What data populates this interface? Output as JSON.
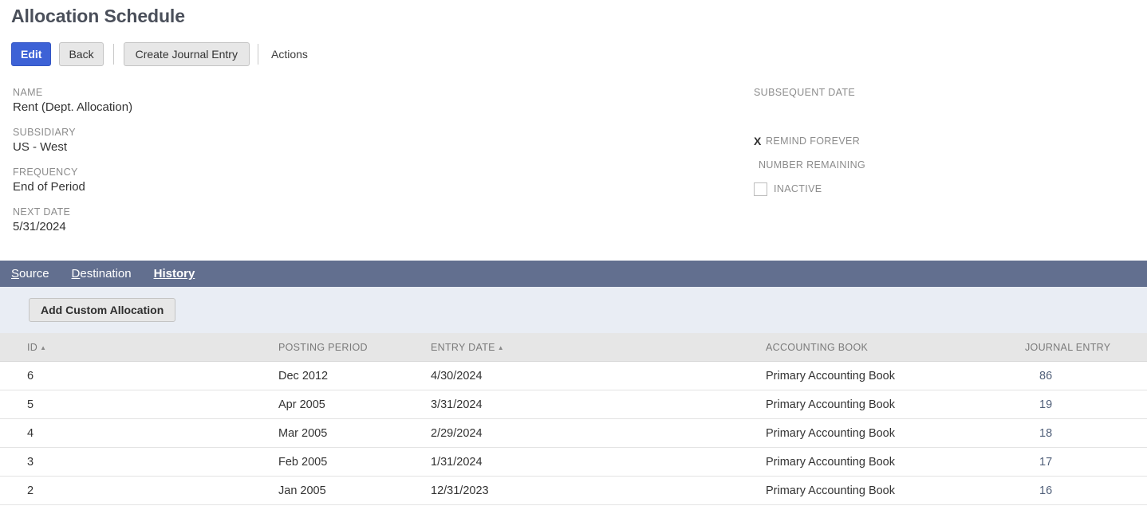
{
  "page": {
    "title": "Allocation Schedule"
  },
  "toolbar": {
    "edit_label": "Edit",
    "back_label": "Back",
    "create_journal_entry_label": "Create Journal Entry",
    "actions_label": "Actions",
    "accent_color": "#3d62d6"
  },
  "fields": {
    "left": [
      {
        "label": "NAME",
        "value": "Rent (Dept. Allocation)"
      },
      {
        "label": "SUBSIDIARY",
        "value": "US - West"
      },
      {
        "label": "FREQUENCY",
        "value": "End of Period"
      },
      {
        "label": "NEXT DATE",
        "value": "5/31/2024"
      }
    ],
    "right": {
      "subsequent_date_label": "SUBSEQUENT DATE",
      "subsequent_date_value": "",
      "remind_forever_label": "REMIND FOREVER",
      "remind_forever_mark": "X",
      "remind_forever_checked": true,
      "number_remaining_label": "NUMBER REMAINING",
      "inactive_label": "INACTIVE",
      "inactive_checked": false
    }
  },
  "tabs": [
    {
      "label": "Source",
      "accesskey": "S",
      "rest": "ource",
      "active": false
    },
    {
      "label": "Destination",
      "accesskey": "D",
      "rest": "estination",
      "active": false
    },
    {
      "label": "History",
      "accesskey": "H",
      "rest": "istory",
      "active": true
    }
  ],
  "sub_toolbar": {
    "add_custom_allocation_label": "Add Custom Allocation",
    "background_color": "#e9edf4"
  },
  "table": {
    "columns": [
      {
        "label": "ID",
        "sort": "asc"
      },
      {
        "label": "POSTING PERIOD",
        "sort": null
      },
      {
        "label": "ENTRY DATE",
        "sort": "asc"
      },
      {
        "label": "ACCOUNTING BOOK",
        "sort": null
      },
      {
        "label": "JOURNAL ENTRY",
        "sort": null
      }
    ],
    "sort_arrow_glyph": "▲",
    "rows": [
      {
        "id": "6",
        "posting_period": "Dec 2012",
        "entry_date": "4/30/2024",
        "accounting_book": "Primary Accounting Book",
        "journal_entry": "86"
      },
      {
        "id": "5",
        "posting_period": "Apr 2005",
        "entry_date": "3/31/2024",
        "accounting_book": "Primary Accounting Book",
        "journal_entry": "19"
      },
      {
        "id": "4",
        "posting_period": "Mar 2005",
        "entry_date": "2/29/2024",
        "accounting_book": "Primary Accounting Book",
        "journal_entry": "18"
      },
      {
        "id": "3",
        "posting_period": "Feb 2005",
        "entry_date": "1/31/2024",
        "accounting_book": "Primary Accounting Book",
        "journal_entry": "17"
      },
      {
        "id": "2",
        "posting_period": "Jan 2005",
        "entry_date": "12/31/2023",
        "accounting_book": "Primary Accounting Book",
        "journal_entry": "16"
      }
    ],
    "link_color": "#51607a"
  }
}
